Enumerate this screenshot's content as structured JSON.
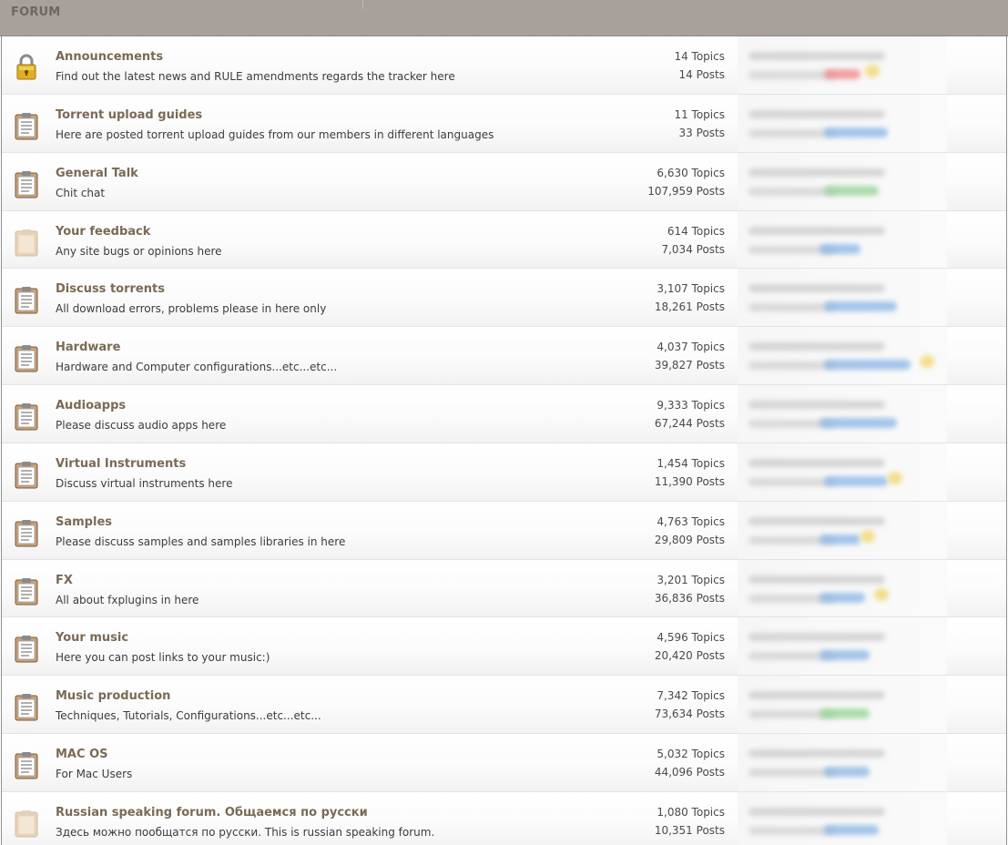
{
  "header": {
    "title": "FORUM"
  },
  "forums": [
    {
      "icon": "lock-icon",
      "icon_color": "#e0b020",
      "title": "Announcements",
      "description": "Find out the latest news and RULE amendments regards the tracker here",
      "topics": "14 Topics",
      "posts": "14 Posts",
      "tag_color": "#f08a8a",
      "dot": true
    },
    {
      "icon": "clipboard-icon",
      "icon_color": "#c9a27a",
      "title": "Torrent upload guides",
      "description": "Here are posted torrent upload guides from our members in different languages",
      "topics": "11 Topics",
      "posts": "33 Posts",
      "tag_color": "#8cb8e6",
      "dot": false
    },
    {
      "icon": "clipboard-icon",
      "icon_color": "#c9a27a",
      "title": "General Talk",
      "description": "Chit chat",
      "topics": "6,630 Topics",
      "posts": "107,959 Posts",
      "tag_color": "#98d498",
      "dot": false
    },
    {
      "icon": "clipboard-faded-icon",
      "icon_color": "#e8d3b8",
      "title": "Your feedback",
      "description": "Any site bugs or opinions here",
      "topics": "614 Topics",
      "posts": "7,034 Posts",
      "tag_color": "#8cb8e6",
      "dot": false
    },
    {
      "icon": "clipboard-icon",
      "icon_color": "#c9a27a",
      "title": "Discuss torrents",
      "description": "All download errors, problems please in here only",
      "topics": "3,107 Topics",
      "posts": "18,261 Posts",
      "tag_color": "#8cb8e6",
      "dot": false
    },
    {
      "icon": "clipboard-icon",
      "icon_color": "#c9a27a",
      "title": "Hardware",
      "description": "Hardware and Computer configurations...etc...etc...",
      "topics": "4,037 Topics",
      "posts": "39,827 Posts",
      "tag_color": "#8cb8e6",
      "dot": true
    },
    {
      "icon": "clipboard-icon",
      "icon_color": "#c9a27a",
      "title": "Audioapps",
      "description": "Please discuss audio apps here",
      "topics": "9,333 Topics",
      "posts": "67,244 Posts",
      "tag_color": "#8cb8e6",
      "dot": false
    },
    {
      "icon": "clipboard-icon",
      "icon_color": "#c9a27a",
      "title": "Virtual Instruments",
      "description": "Discuss virtual instruments here",
      "topics": "1,454 Topics",
      "posts": "11,390 Posts",
      "tag_color": "#8cb8e6",
      "dot": true
    },
    {
      "icon": "clipboard-icon",
      "icon_color": "#c9a27a",
      "title": "Samples",
      "description": "Please discuss samples and samples libraries in here",
      "topics": "4,763 Topics",
      "posts": "29,809 Posts",
      "tag_color": "#8cb8e6",
      "dot": true
    },
    {
      "icon": "clipboard-icon",
      "icon_color": "#c9a27a",
      "title": "FX",
      "description": "All about fxplugins in here",
      "topics": "3,201 Topics",
      "posts": "36,836 Posts",
      "tag_color": "#8cb8e6",
      "dot": true
    },
    {
      "icon": "clipboard-icon",
      "icon_color": "#c9a27a",
      "title": "Your music",
      "description": "Here you can post links to your music:)",
      "topics": "4,596 Topics",
      "posts": "20,420 Posts",
      "tag_color": "#8cb8e6",
      "dot": false
    },
    {
      "icon": "clipboard-icon",
      "icon_color": "#c9a27a",
      "title": "Music production",
      "description": "Techniques, Tutorials, Configurations...etc...etc...",
      "topics": "7,342 Topics",
      "posts": "73,634 Posts",
      "tag_color": "#98d498",
      "dot": false
    },
    {
      "icon": "clipboard-icon",
      "icon_color": "#c9a27a",
      "title": "MAC OS",
      "description": "For Mac Users",
      "topics": "5,032 Topics",
      "posts": "44,096 Posts",
      "tag_color": "#8cb8e6",
      "dot": false
    },
    {
      "icon": "clipboard-faded-icon",
      "icon_color": "#e8d3b8",
      "title": "Russian speaking forum. Общаемся по русски",
      "description": "Здесь можно пообщатся по русски. This is russian speaking forum.",
      "topics": "1,080 Topics",
      "posts": "10,351 Posts",
      "tag_color": "#8cb8e6",
      "dot": false
    }
  ]
}
